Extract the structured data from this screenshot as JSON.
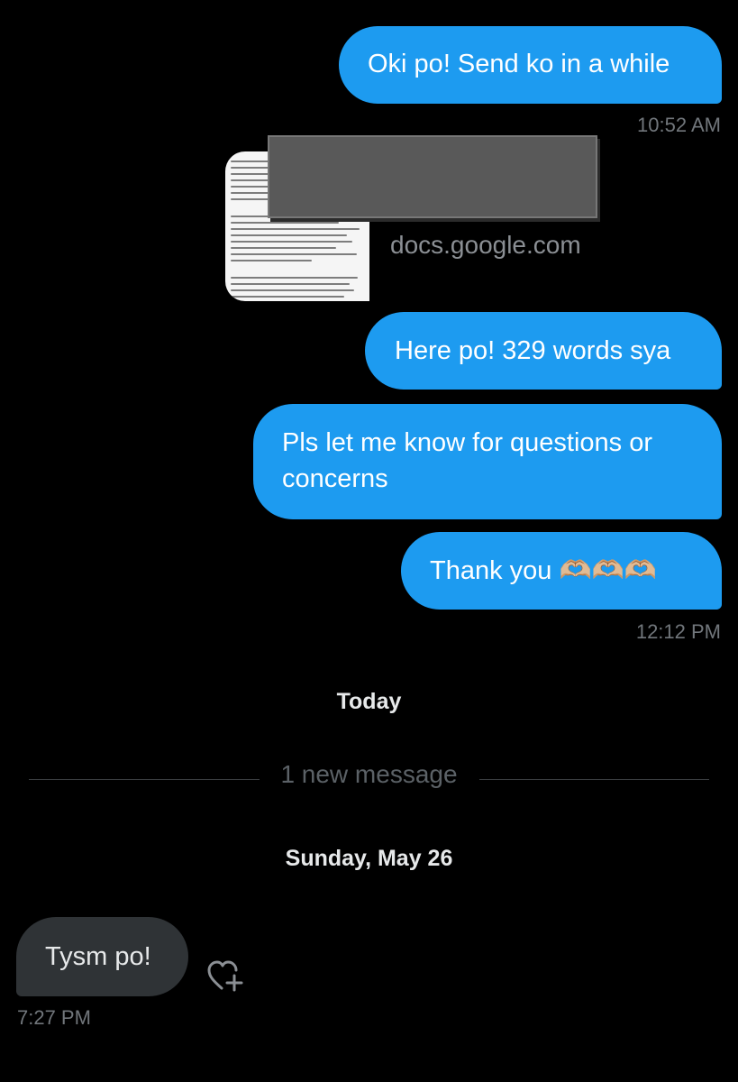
{
  "messages": {
    "m1": {
      "text": "Oki po! Send ko in a while",
      "time": "10:52 AM"
    },
    "link_preview": {
      "domain": "docs.google.com"
    },
    "m2": {
      "text": "Here po! 329 words sya"
    },
    "m3": {
      "text": "Pls let me know for questions or concerns"
    },
    "m4": {
      "text": "Thank you 🫶🏼🫶🏼🫶🏼",
      "time": "12:12 PM"
    }
  },
  "separators": {
    "today": "Today",
    "new_messages": "1 new message",
    "day": "Sunday, May 26"
  },
  "incoming": {
    "text": "Tysm po!",
    "time": "7:27 PM"
  },
  "icons": {
    "react": "heart-add-icon"
  },
  "colors": {
    "background": "#000000",
    "outgoing_bubble": "#1d9bf0",
    "incoming_bubble": "#2f3336",
    "timestamp": "#71767b"
  }
}
